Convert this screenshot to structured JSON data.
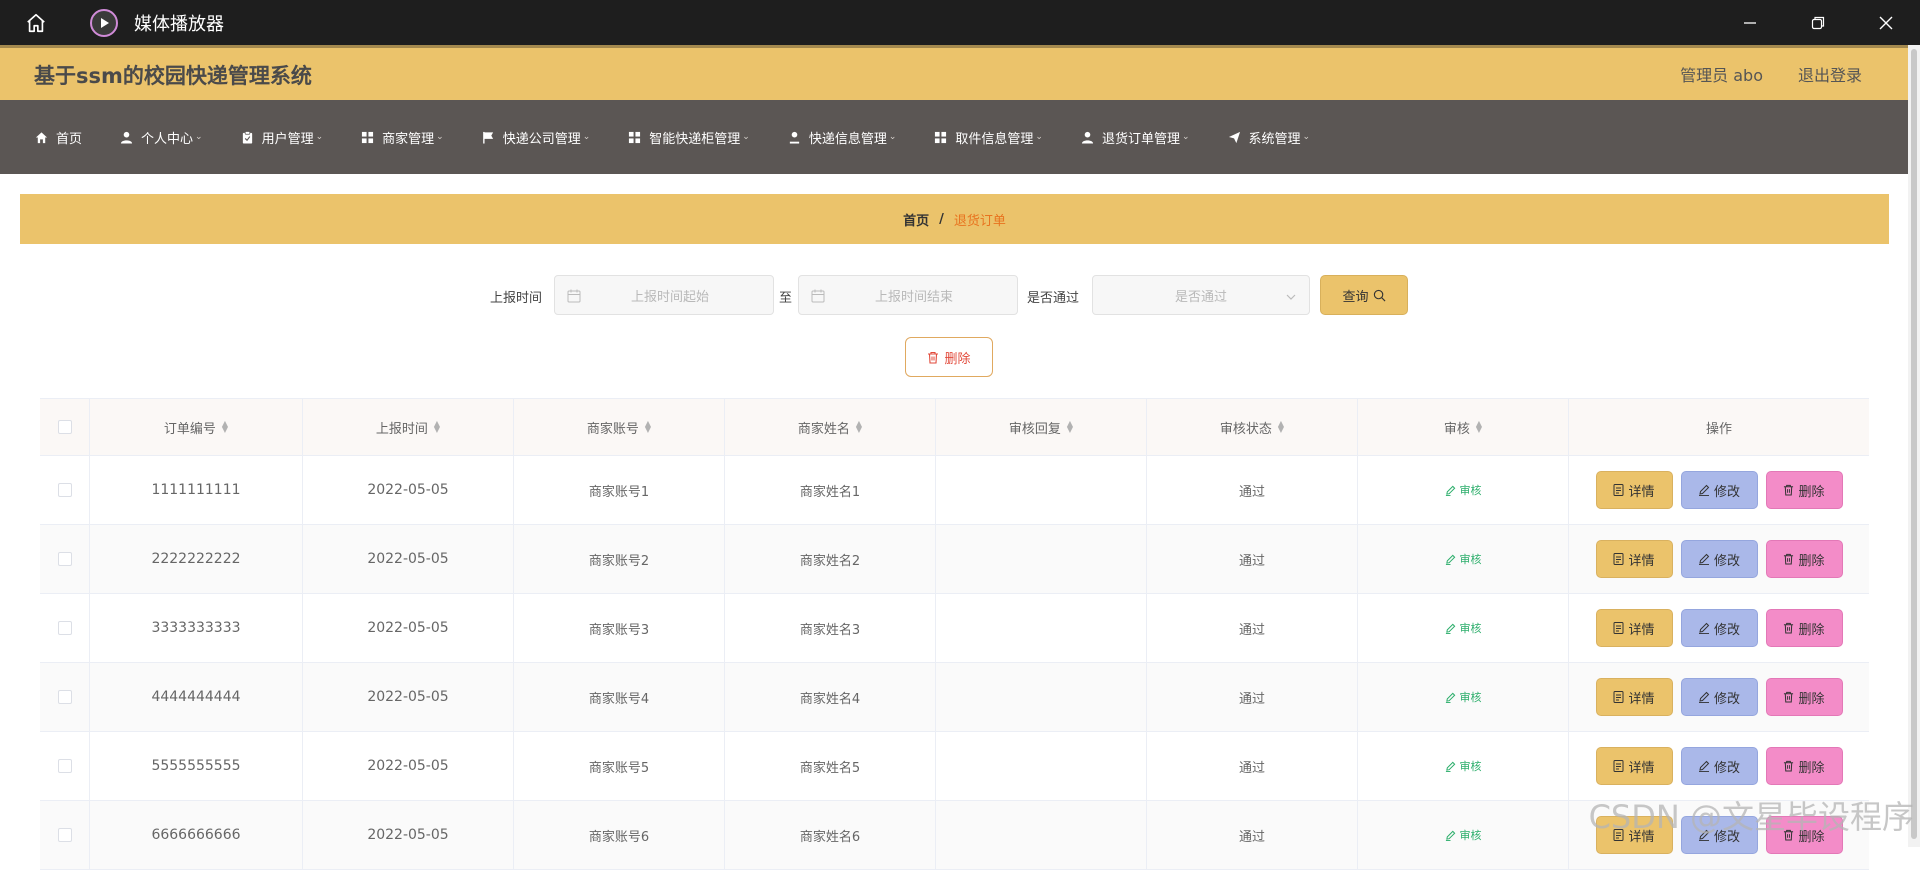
{
  "window": {
    "title": "媒体播放器"
  },
  "header": {
    "site_name": "基于ssm的校园快递管理系统",
    "admin_label": "管理员 abo",
    "logout": "退出登录"
  },
  "nav": [
    {
      "label": "首页",
      "icon": "home-icon"
    },
    {
      "label": "个人中心",
      "icon": "user-icon",
      "caret": "⌄"
    },
    {
      "label": "用户管理",
      "icon": "clipboard-icon",
      "caret": "⌄"
    },
    {
      "label": "商家管理",
      "icon": "grid-icon",
      "caret": "⌄"
    },
    {
      "label": "快递公司管理",
      "icon": "flag-icon",
      "caret": "⌄"
    },
    {
      "label": "智能快递柜管理",
      "icon": "grid-icon",
      "caret": "⌄"
    },
    {
      "label": "快递信息管理",
      "icon": "user-icon",
      "caret": "⌄"
    },
    {
      "label": "取件信息管理",
      "icon": "grid-icon",
      "caret": "⌄"
    },
    {
      "label": "退货订单管理",
      "icon": "user-icon",
      "caret": "⌄"
    },
    {
      "label": "系统管理",
      "icon": "send-icon",
      "caret": "⌄"
    }
  ],
  "breadcrumb": {
    "home": "首页",
    "separator": "/",
    "current": "退货订单"
  },
  "search": {
    "report_time_label": "上报时间",
    "start_placeholder": "上报时间起始",
    "to_label": "至",
    "end_placeholder": "上报时间结束",
    "pass_label": "是否通过",
    "pass_placeholder": "是否通过",
    "query_button": "查询"
  },
  "actions": {
    "delete_button": "删除"
  },
  "table": {
    "columns": [
      "订单编号",
      "上报时间",
      "商家账号",
      "商家姓名",
      "审核回复",
      "审核状态",
      "审核",
      "操作"
    ],
    "rows": [
      {
        "order_no": "1111111111",
        "report_time": "2022-05-05",
        "merchant_account": "商家账号1",
        "merchant_name": "商家姓名1",
        "reply": "",
        "status": "通过",
        "audit": "审核"
      },
      {
        "order_no": "2222222222",
        "report_time": "2022-05-05",
        "merchant_account": "商家账号2",
        "merchant_name": "商家姓名2",
        "reply": "",
        "status": "通过",
        "audit": "审核"
      },
      {
        "order_no": "3333333333",
        "report_time": "2022-05-05",
        "merchant_account": "商家账号3",
        "merchant_name": "商家姓名3",
        "reply": "",
        "status": "通过",
        "audit": "审核"
      },
      {
        "order_no": "4444444444",
        "report_time": "2022-05-05",
        "merchant_account": "商家账号4",
        "merchant_name": "商家姓名4",
        "reply": "",
        "status": "通过",
        "audit": "审核"
      },
      {
        "order_no": "5555555555",
        "report_time": "2022-05-05",
        "merchant_account": "商家账号5",
        "merchant_name": "商家姓名5",
        "reply": "",
        "status": "通过",
        "audit": "审核"
      },
      {
        "order_no": "6666666666",
        "report_time": "2022-05-05",
        "merchant_account": "商家账号6",
        "merchant_name": "商家姓名6",
        "reply": "",
        "status": "通过",
        "audit": "审核"
      }
    ],
    "row_buttons": {
      "detail": "详情",
      "edit": "修改",
      "delete": "删除"
    }
  },
  "watermark": "CSDN @文星毕设程序",
  "colors": {
    "accent": "#ebc36b",
    "nav_bg": "#5b5654",
    "breadcrumb_current": "#e8731f",
    "edit_button": "#aab8e9",
    "delete_button": "#f38cc8",
    "audit_link": "#2cae6b"
  }
}
